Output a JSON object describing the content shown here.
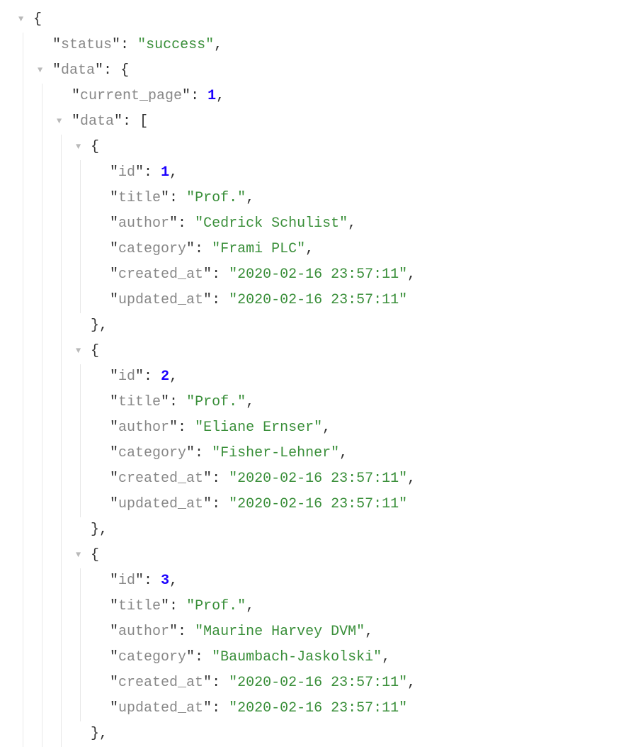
{
  "glyphs": {
    "toggle_open": "▼"
  },
  "punct": {
    "colon": ":",
    "comma": ",",
    "q": "\"",
    "obrace": "{",
    "cbrace": "}",
    "obracket": "["
  },
  "root": {
    "status_key": "status",
    "status_val": "success",
    "data_key": "data",
    "data_obj": {
      "current_page_key": "current_page",
      "current_page_val": "1",
      "data_key": "data",
      "items": [
        {
          "id_key": "id",
          "id_val": "1",
          "title_key": "title",
          "title_val": "Prof.",
          "author_key": "author",
          "author_val": "Cedrick Schulist",
          "category_key": "category",
          "category_val": "Frami PLC",
          "created_key": "created_at",
          "created_val": "2020-02-16 23:57:11",
          "updated_key": "updated_at",
          "updated_val": "2020-02-16 23:57:11"
        },
        {
          "id_key": "id",
          "id_val": "2",
          "title_key": "title",
          "title_val": "Prof.",
          "author_key": "author",
          "author_val": "Eliane Ernser",
          "category_key": "category",
          "category_val": "Fisher-Lehner",
          "created_key": "created_at",
          "created_val": "2020-02-16 23:57:11",
          "updated_key": "updated_at",
          "updated_val": "2020-02-16 23:57:11"
        },
        {
          "id_key": "id",
          "id_val": "3",
          "title_key": "title",
          "title_val": "Prof.",
          "author_key": "author",
          "author_val": "Maurine Harvey DVM",
          "category_key": "category",
          "category_val": "Baumbach-Jaskolski",
          "created_key": "created_at",
          "created_val": "2020-02-16 23:57:11",
          "updated_key": "updated_at",
          "updated_val": "2020-02-16 23:57:11"
        }
      ]
    }
  }
}
